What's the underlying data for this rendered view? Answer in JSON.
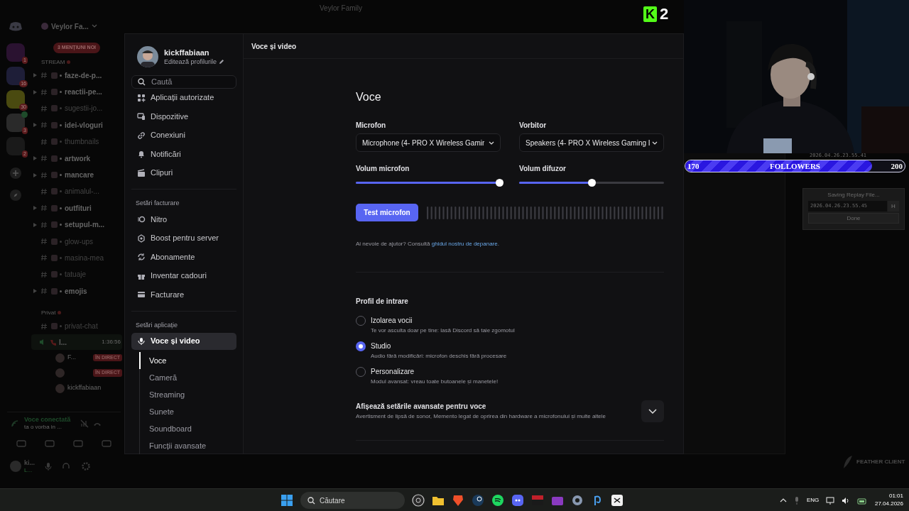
{
  "window": {
    "title": "Veylor Family"
  },
  "stream_logo": {
    "letter": "K",
    "count": "2"
  },
  "discord": {
    "server_name": "Veylor Fa...",
    "mentions_banner": "3 MENȚIUNI NOI",
    "servers": [
      {
        "badge": "1",
        "in_voice": false
      },
      {
        "badge": "16",
        "in_voice": false
      },
      {
        "badge": "30",
        "in_voice": false
      },
      {
        "badge": "3",
        "in_voice": true
      },
      {
        "badge": "2",
        "in_voice": false
      }
    ],
    "categories": [
      {
        "name": "STREAM",
        "channels": [
          {
            "name": "faze-de-p...",
            "unread": true
          },
          {
            "name": "reactii-pe...",
            "unread": true
          },
          {
            "name": "sugestii-jo...",
            "unread": false
          },
          {
            "name": "idei-vloguri",
            "unread": true
          },
          {
            "name": "thumbnails",
            "unread": false
          },
          {
            "name": "artwork",
            "unread": true
          },
          {
            "name": "mancare",
            "unread": true
          },
          {
            "name": "animalul-...",
            "unread": false
          },
          {
            "name": "outfituri",
            "unread": true
          },
          {
            "name": "setupul-m...",
            "unread": true
          },
          {
            "name": "glow-ups",
            "unread": false
          },
          {
            "name": "masina-mea",
            "unread": false
          },
          {
            "name": "tatuaje",
            "unread": false
          },
          {
            "name": "emojis",
            "unread": true
          }
        ]
      },
      {
        "name": "Privat",
        "channels": [
          {
            "name": "privat-chat",
            "unread": false
          }
        ]
      }
    ],
    "voice_channel": {
      "name": "l...",
      "duration": "1:36:56",
      "members": [
        {
          "name": "F...",
          "live": "ÎN DIRECT"
        },
        {
          "live": "ÎN DIRECT"
        },
        {
          "name": "kickffabiaan"
        }
      ]
    },
    "voice_panel": {
      "status": "Voce conectată",
      "channel": "ta o vorba in ..."
    },
    "user": {
      "name": "ki...",
      "status": "L..."
    }
  },
  "settings": {
    "profile": {
      "name": "kickffabiaan",
      "edit": "Editează profilurile"
    },
    "search": {
      "placeholder": "Caută"
    },
    "groups": [
      {
        "items": [
          {
            "label": "Aplicații autorizate",
            "selected": false
          },
          {
            "label": "Dispozitive",
            "selected": false
          },
          {
            "label": "Conexiuni",
            "selected": false
          },
          {
            "label": "Notificări",
            "selected": false
          },
          {
            "label": "Clipuri",
            "selected": false
          }
        ]
      },
      {
        "heading": "Setări facturare",
        "items": [
          {
            "label": "Nitro",
            "selected": false
          },
          {
            "label": "Boost pentru server",
            "selected": false
          },
          {
            "label": "Abonamente",
            "selected": false
          },
          {
            "label": "Inventar cadouri",
            "selected": false
          },
          {
            "label": "Facturare",
            "selected": false
          }
        ]
      },
      {
        "heading": "Setări aplicație",
        "items": [
          {
            "label": "Voce și video",
            "selected": true,
            "children": [
              {
                "label": "Voce",
                "selected": true
              },
              {
                "label": "Cameră",
                "selected": false
              },
              {
                "label": "Streaming",
                "selected": false
              },
              {
                "label": "Sunete",
                "selected": false
              },
              {
                "label": "Soundboard",
                "selected": false
              },
              {
                "label": "Funcții avansate",
                "selected": false
              }
            ]
          }
        ]
      }
    ],
    "page_title": "Voce și video",
    "section_title": "Voce",
    "devices": [
      {
        "label": "Microfon",
        "value": "Microphone (4- PRO X Wireless Gamir",
        "volume_label": "Volum microfon",
        "level": 0.99
      },
      {
        "label": "Vorbitor",
        "value": "Speakers (4- PRO X Wireless Gaming I",
        "volume_label": "Volum difuzor",
        "level": 0.5
      }
    ],
    "test_button": "Test microfon",
    "help": {
      "text": "Ai nevoie de ajutor? Consultă",
      "link": "ghidul nostru de depanare",
      "suffix": "."
    },
    "input_profile": {
      "title": "Profil de intrare",
      "options": [
        {
          "label": "Izolarea vocii",
          "description": "Te vor asculta doar pe tine: lasă Discord să taie zgomotul",
          "selected": false
        },
        {
          "label": "Studio",
          "description": "Audio fără modificări: microfon deschis fără procesare",
          "selected": true
        },
        {
          "label": "Personalizare",
          "description": "Modul avansat: vreau toate butoanele și manetele!",
          "selected": false
        }
      ]
    },
    "advanced": {
      "title": "Afișează setările avansate pentru voce",
      "description": "Avertisment de lipsă de sonor, Memento legat de oprirea din hardware a microfonului și multe altele",
      "expanded": false
    }
  },
  "followers_bar": {
    "start": "170",
    "label": "FOLLOWERS",
    "end": "200",
    "level": 0.85
  },
  "replay": {
    "previous_file": "2026.04.26.23.55.41",
    "title": "Saving Replay File...",
    "file": "2026.04.26.23.55.45",
    "key": "H",
    "button": "Done"
  },
  "feather": {
    "label": "FEATHER CLIENT"
  },
  "taskbar": {
    "search_placeholder": "Căutare",
    "language": "ENG",
    "time": "01:01",
    "date": "27.04.2026"
  }
}
